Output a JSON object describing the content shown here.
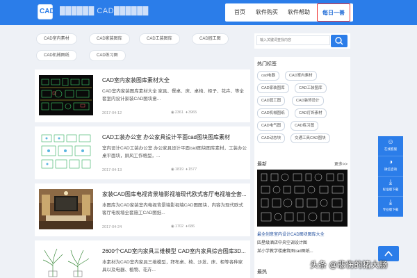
{
  "header": {
    "logo_text": "CAD",
    "site_name": "██████ CAD██████",
    "nav": [
      {
        "label": "首页"
      },
      {
        "label": "软件购买"
      },
      {
        "label": "软件帮助"
      },
      {
        "label": "每日一善"
      }
    ]
  },
  "category_tags": [
    "CAD室内素材",
    "CAD家装图库",
    "CAD工装图库",
    "CAD园工图",
    "CAD机械图纸",
    "CAD练习图"
  ],
  "articles": [
    {
      "title": "CAD室内家装图库素材大全",
      "desc": "CAD室内家装图库素材大全 家具、餐桌、床、桌椅、柜子、花卉、等全套室内设计家装CAD图块意...",
      "date": "2017-04-12",
      "views": "2361",
      "likes": "3965"
    },
    {
      "title": "CAD工装办公室 办公家具设计平面cad图块图库素材",
      "desc": "室内设计CAD工装办公室 办公家具设计平面cad图块图库素材，工装办公桌平面块，屏风工作格型，...",
      "date": "2017-04-13",
      "views": "1819",
      "likes": "1577"
    },
    {
      "title": "家装CAD图库电视背景墙影视墙现代欧式客厅电视墙全套...",
      "desc": "本图库为CAD家装室内电视背景墙影视墙CAD图图块，内容为现代欧式客厅电视墙全套施工CAD图纸...",
      "date": "2017-04-24",
      "views": "1702",
      "likes": "686"
    },
    {
      "title": "2600个CAD室内家具三维模型 CAD室内家具综合图库3D...",
      "desc": "本素材为CAD室内家具三维模型，拜布桌、椅、沙发、床、柜等各种家具以及电器、植物、花卉...",
      "date": "",
      "views": "",
      "likes": ""
    }
  ],
  "sidebar": {
    "search_placeholder": "输入关键词查找内容",
    "hot_title": "热门标签",
    "hot_tags": [
      "cad电器",
      "CAD室内素材",
      "CAD家装图库",
      "CAD工装图库",
      "CAD园工图",
      "CAD装饰设计",
      "CAD机械图纸",
      "CAD灯饰素材",
      "CAD电气图",
      "CAD练习图",
      "CAD动态块",
      "交通工具CAD图块"
    ],
    "latest_title": "最新",
    "latest_more": "更多>>",
    "latest_item_title": "最全创意室内设计CAD图块图库大全",
    "latest_line2": "四星级酒店中央空调设计图",
    "latest_line3": "某小学教学楼建筑图cad图纸...",
    "bottom_title": "最热"
  },
  "float_bar": [
    {
      "label": "在线客服",
      "icon": "chat-icon"
    },
    {
      "label": "微信咨询",
      "icon": "wechat-icon"
    },
    {
      "label": "标准版下载",
      "icon": "download-icon"
    },
    {
      "label": "专业版下载",
      "icon": "download-icon"
    }
  ],
  "watermark": "头条 @悲伤的猪大肠",
  "colors": {
    "primary": "#2b7de9",
    "highlight": "#e33333",
    "background": "#eef1f6"
  }
}
